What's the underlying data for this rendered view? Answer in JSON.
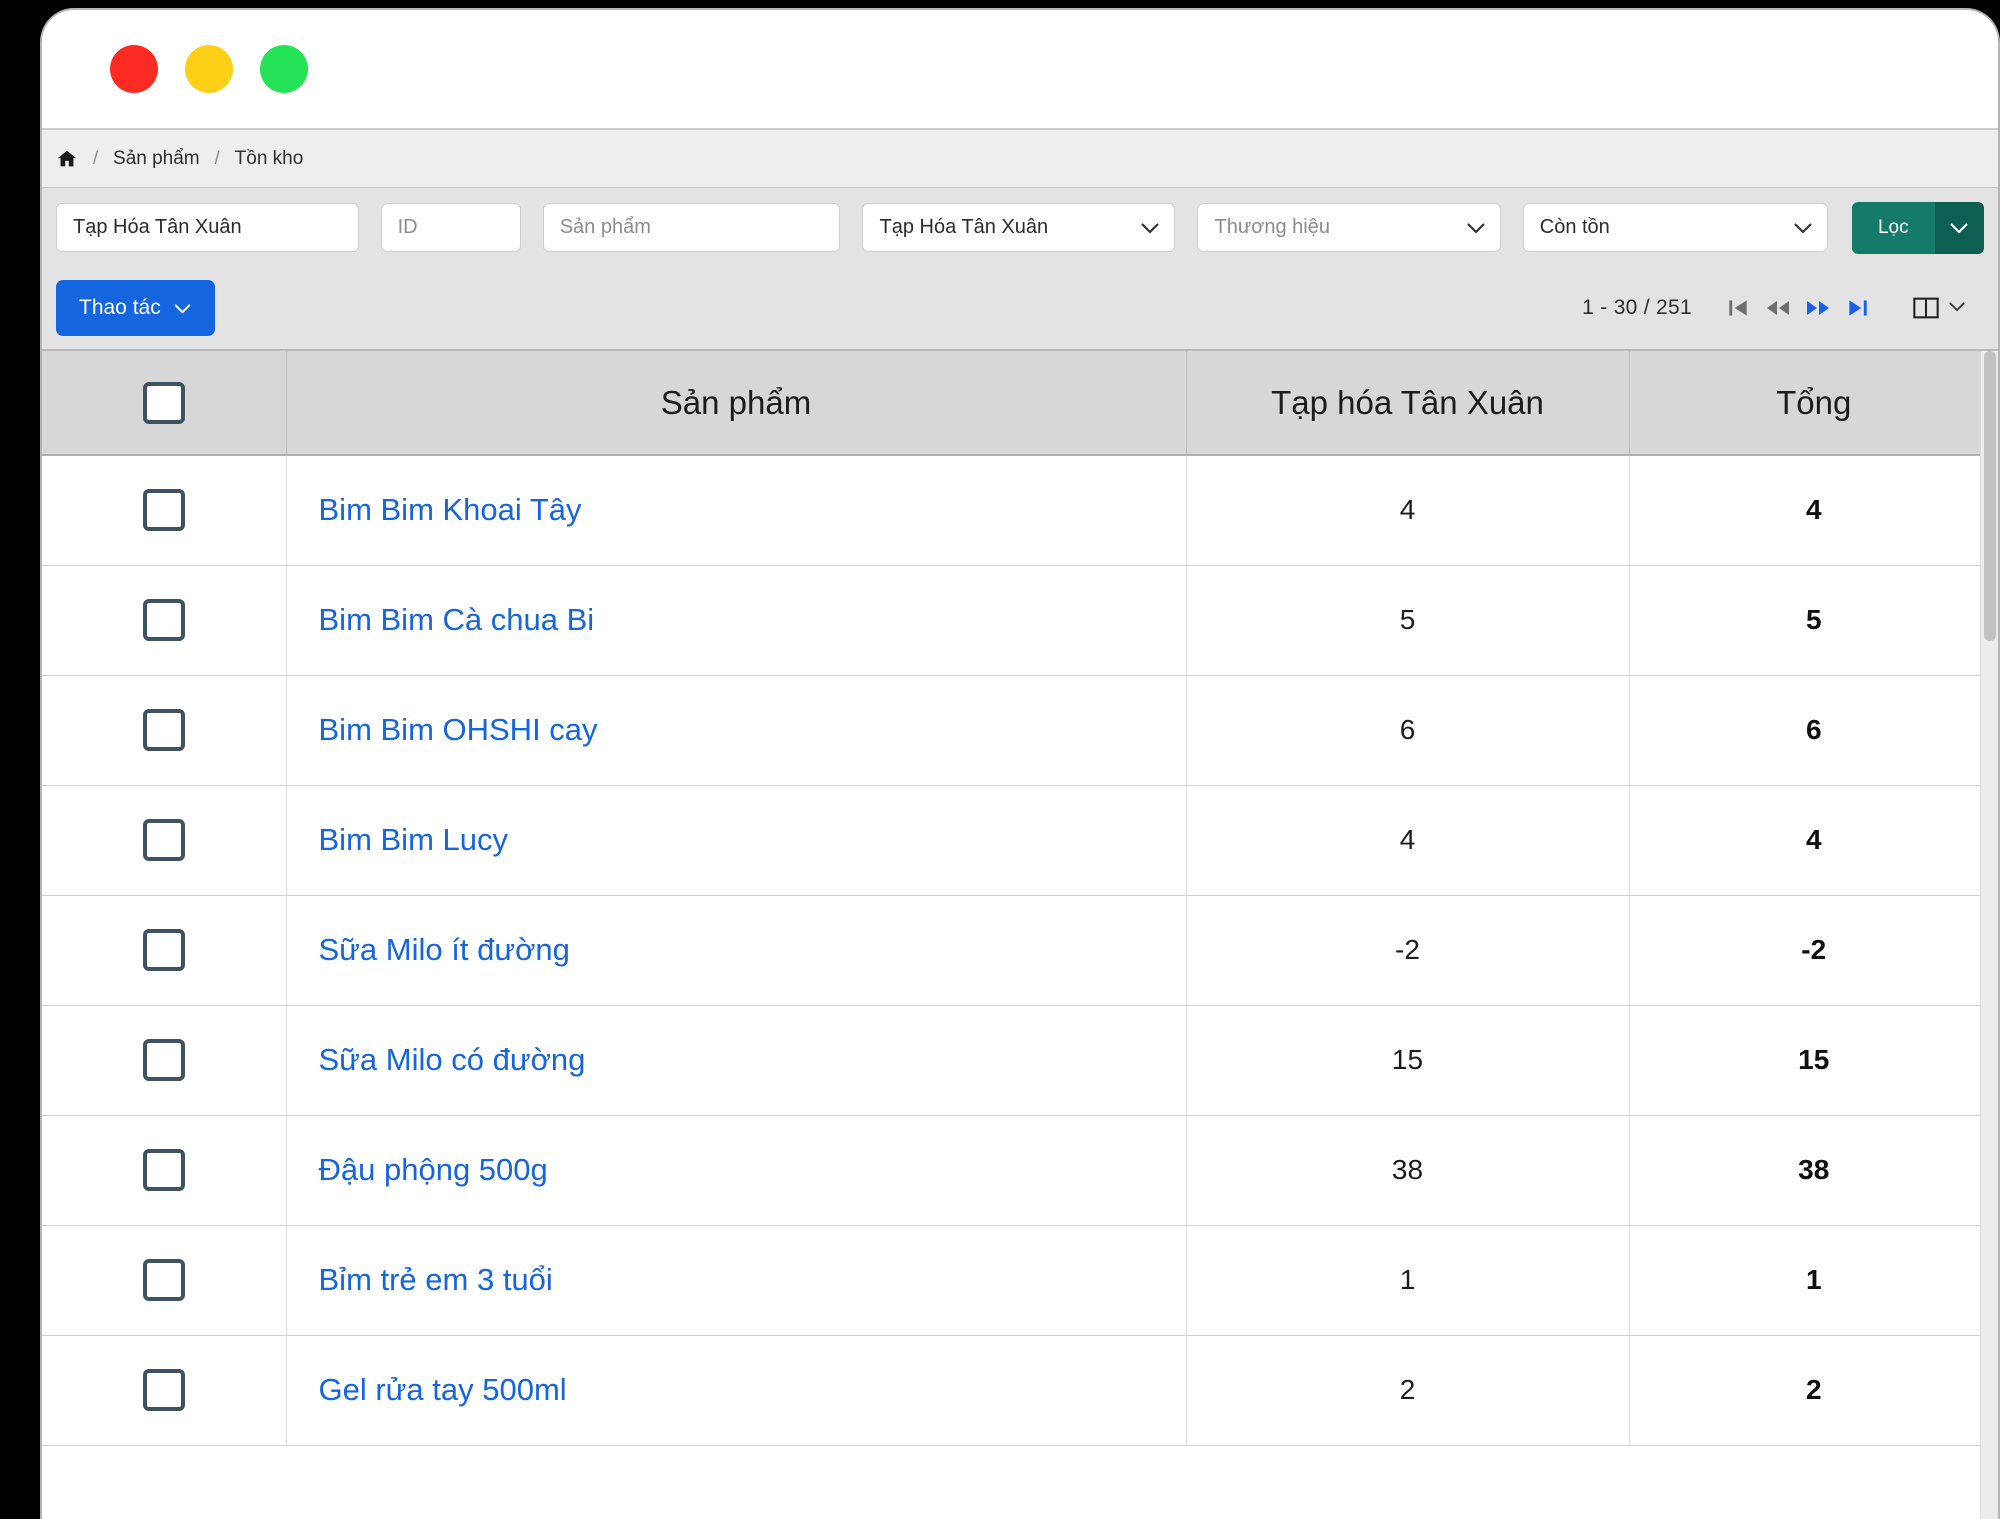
{
  "window": {
    "traffic_lights": [
      {
        "name": "close",
        "color": "#fb2b23"
      },
      {
        "name": "minimize",
        "color": "#fdd017"
      },
      {
        "name": "maximize",
        "color": "#24e356"
      }
    ]
  },
  "breadcrumb": {
    "home_icon": "home-icon",
    "separator": "/",
    "items": [
      "Sản phẩm",
      "Tồn kho"
    ]
  },
  "filters": {
    "store_text": {
      "value": "Tạp Hóa Tân Xuân",
      "placeholder": ""
    },
    "id": {
      "value": "",
      "placeholder": "ID"
    },
    "product": {
      "value": "",
      "placeholder": "Sản phẩm"
    },
    "store_select": {
      "value": "Tạp Hóa Tân Xuân"
    },
    "brand_select": {
      "value": "Thương hiệu"
    },
    "stock_select": {
      "value": "Còn tồn"
    },
    "filter_button": {
      "label": "Lọc",
      "color": "#157a6a",
      "caret_color": "#0d5f52"
    }
  },
  "toolbar": {
    "action_label": "Thao tác",
    "action_color": "#1565e0",
    "pagination": {
      "range": "1 - 30 / 251",
      "first_label": "first-page",
      "prev_label": "previous-page",
      "next_label": "next-page",
      "last_label": "last-page",
      "first_enabled": false,
      "prev_enabled": false,
      "next_enabled": true,
      "last_enabled": true,
      "disabled_color": "#6e6e6e",
      "enabled_color": "#1a5ef0"
    },
    "column_toggle_label": "column-layout"
  },
  "table": {
    "columns": [
      "",
      "Sản phẩm",
      "Tạp hóa Tân Xuân",
      "Tổng"
    ],
    "rows": [
      {
        "product": "Bim Bim Khoai Tây",
        "store": "4",
        "total": "4"
      },
      {
        "product": "Bim Bim Cà chua Bi",
        "store": "5",
        "total": "5"
      },
      {
        "product": "Bim Bim OHSHI cay",
        "store": "6",
        "total": "6"
      },
      {
        "product": "Bim Bim Lucy",
        "store": "4",
        "total": "4"
      },
      {
        "product": "Sữa Milo ít đường",
        "store": "-2",
        "total": "-2"
      },
      {
        "product": "Sữa Milo có đường",
        "store": "15",
        "total": "15"
      },
      {
        "product": "Đậu phộng 500g",
        "store": "38",
        "total": "38"
      },
      {
        "product": "Bỉm trẻ em 3 tuổi",
        "store": "1",
        "total": "1"
      },
      {
        "product": "Gel rửa tay 500ml",
        "store": "2",
        "total": "2"
      }
    ]
  },
  "colors": {
    "link": "#1565e0",
    "header_bg": "#d7d7d7",
    "toolbar_bg": "#e3e3e3",
    "breadcrumb_bg": "#eeeeee"
  }
}
